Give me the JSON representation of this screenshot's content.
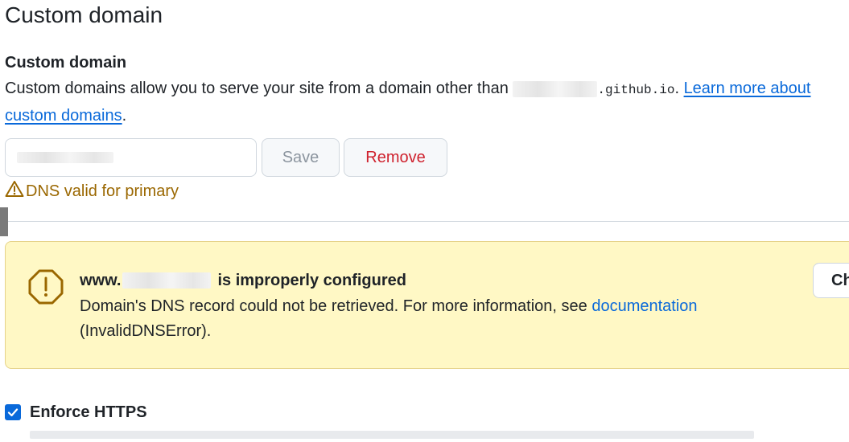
{
  "header": {
    "title": "Custom domain"
  },
  "custom_domain": {
    "heading": "Custom domain",
    "description_before": "Custom domains allow you to serve your site from a domain other than",
    "github_suffix": ".github.io",
    "period": ".",
    "learn_more_link": "Learn more about custom domains",
    "trailing_period": ".",
    "save_label": "Save",
    "remove_label": "Remove",
    "dns_status": "DNS valid for primary"
  },
  "alert": {
    "title_prefix": "www.",
    "title_suffix": "is improperly configured",
    "body_text": "Domain's DNS record could not be retrieved. For more information, see",
    "link_text": "documentation",
    "error_code": "(InvalidDNSError).",
    "button_label": "Che"
  },
  "https": {
    "label": "Enforce HTTPS",
    "checked": true
  },
  "colors": {
    "accent": "#0969da",
    "danger": "#cf222e",
    "warning_text": "#9a6700",
    "warning_bg": "#fff8c5"
  },
  "icons": [
    "alert-triangle-icon",
    "stop-warning-icon",
    "checkmark-icon"
  ]
}
